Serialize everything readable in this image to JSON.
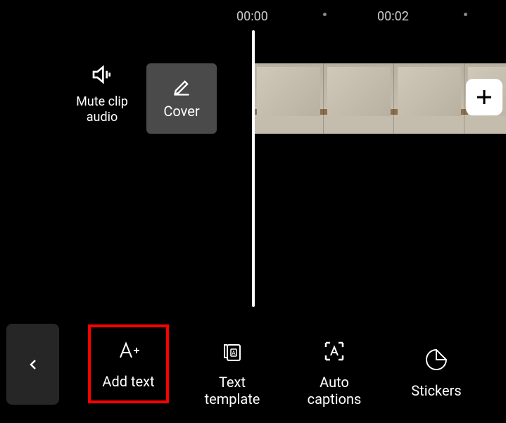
{
  "ruler": {
    "time1": "00:00",
    "time2": "00:02"
  },
  "controls": {
    "mute_label": "Mute clip\naudio",
    "cover_label": "Cover"
  },
  "tools": {
    "add_text_label": "Add text",
    "text_template_label": "Text\ntemplate",
    "auto_captions_label": "Auto\ncaptions",
    "stickers_label": "Stickers"
  }
}
